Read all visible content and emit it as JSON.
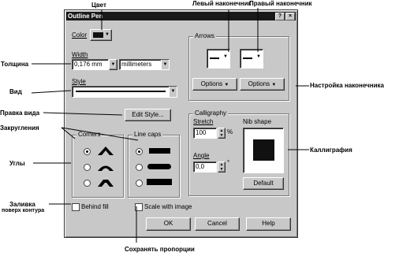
{
  "dialog": {
    "title": "Outline Pen",
    "close_glyph": "×",
    "help_glyph": "?",
    "color_label": "Color",
    "width_label": "Width",
    "width_value": "0,176 mm",
    "units_value": "millimeters",
    "style_label": "Style",
    "edit_style_label": "Edit Style...",
    "corners_label": "Corners",
    "line_caps_label": "Line caps",
    "behind_fill_label": "Behind fill",
    "scale_image_label": "Scale with image",
    "arrows_label": "Arrows",
    "options_left_label": "Options",
    "options_right_label": "Options",
    "calligraphy_label": "Calligraphy",
    "stretch_label": "Stretch",
    "stretch_value": "100",
    "stretch_unit": "%",
    "angle_label": "Angle",
    "angle_value": "0,0",
    "angle_unit": "°",
    "nib_shape_label": "Nib shape",
    "default_label": "Default",
    "ok_label": "OK",
    "cancel_label": "Cancel",
    "help_label": "Help"
  },
  "callouts": {
    "color": "Цвет",
    "left_arrow": "Левый наконечник",
    "right_arrow": "Правый наконечник",
    "thickness": "Толщина",
    "kind": "Вид",
    "edit_kind": "Правка вида",
    "rounding": "Закругления",
    "corners": "Углы",
    "fill_under": "Заливка",
    "fill_under2": "поверх контура",
    "arrow_settings": "Настройка наконечника",
    "calligraphy": "Каллиграфия",
    "keep_proportions": "Сохранять пропорции"
  }
}
